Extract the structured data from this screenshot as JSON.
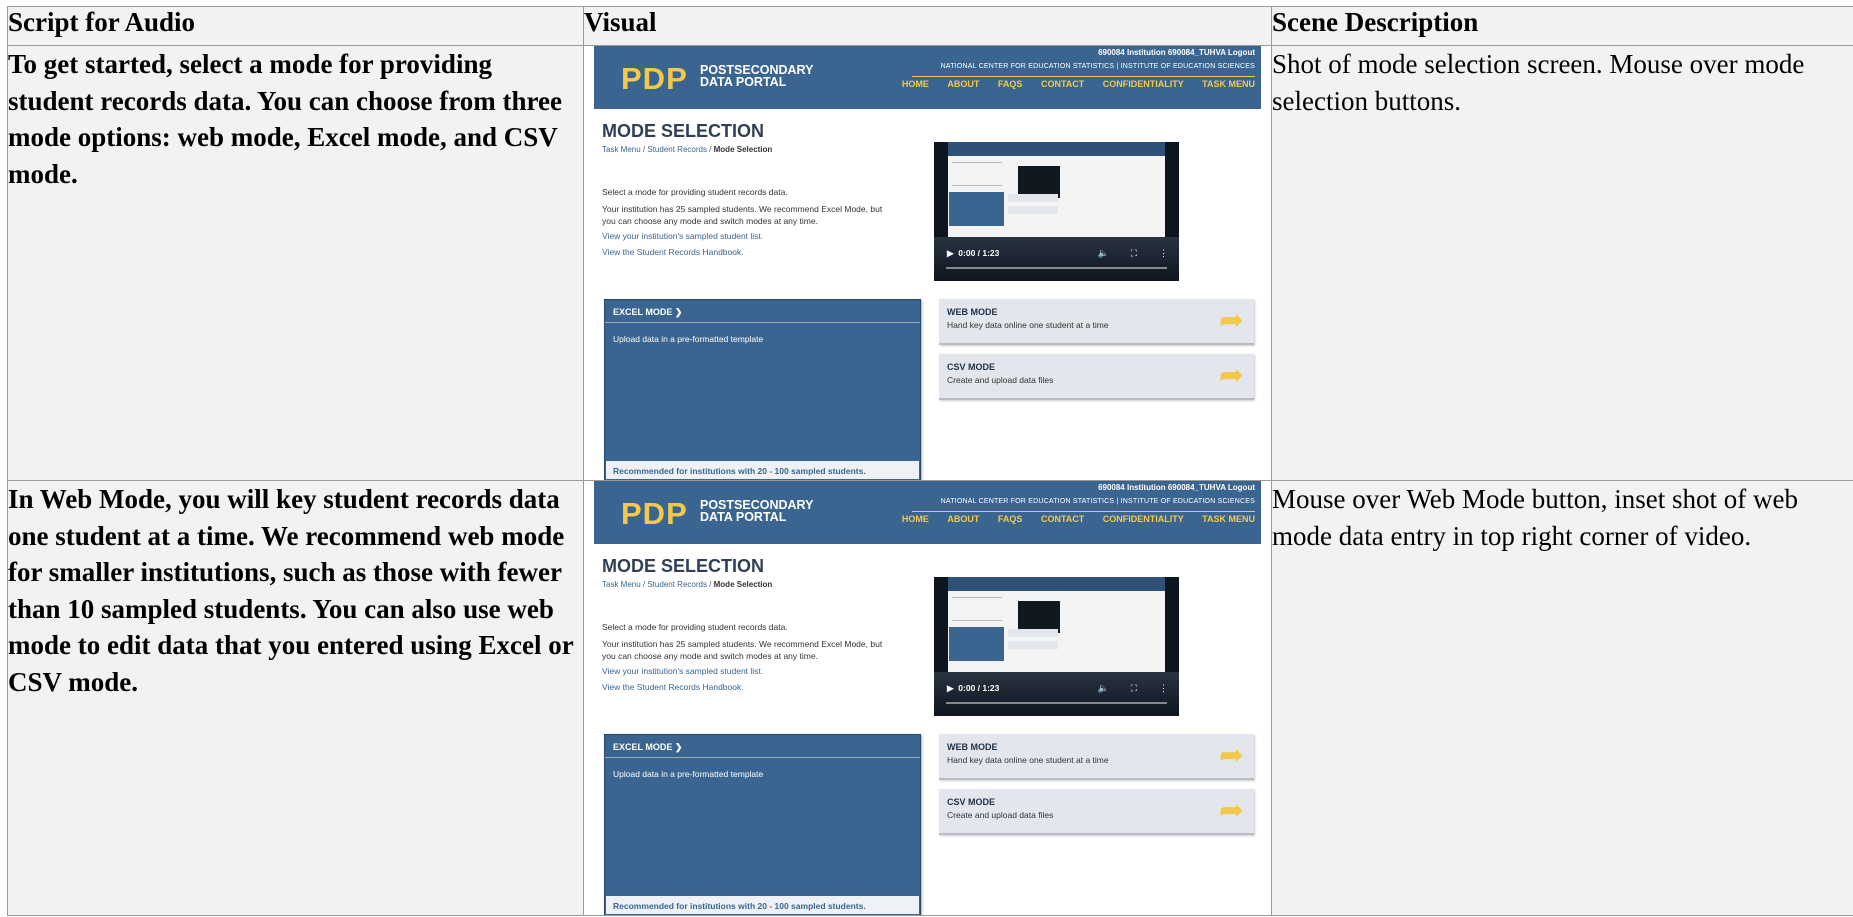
{
  "headers": {
    "script": "Script for Audio",
    "visual": "Visual",
    "scene": "Scene Description"
  },
  "rows": [
    {
      "script": "To get started, select a mode for providing student records data. You can choose from three mode options: web mode, Excel mode, and CSV mode.",
      "scene": "Shot of mode selection screen. Mouse over mode selection buttons."
    },
    {
      "script": "In Web Mode, you will key student records data one student at a time. We recommend web mode for smaller institutions, such as those with fewer than 10 sampled students. You can also use web mode to edit data that you entered using Excel or CSV mode.",
      "scene": "Mouse over Web Mode button, inset shot of web mode data entry in top right corner of video."
    }
  ],
  "portal": {
    "logo_mark": "PDP",
    "logo_line1": "POSTSECONDARY",
    "logo_line2": "DATA PORTAL",
    "account": "690084 Institution  690084_TUHVA   Logout",
    "agency": "NATIONAL CENTER FOR EDUCATION STATISTICS  |  INSTITUTE OF EDUCATION SCIENCES",
    "nav": [
      "HOME",
      "ABOUT",
      "FAQS",
      "CONTACT",
      "CONFIDENTIALITY",
      "TASK MENU"
    ],
    "title": "MODE SELECTION",
    "crumb_link1": "Task Menu",
    "crumb_link2": "Student Records",
    "crumb_current": "Mode Selection",
    "sep": " / ",
    "intro": "Select a mode for providing student records data.",
    "recommend": "Your institution has 25 sampled students. We recommend Excel Mode, but you can choose any mode and switch modes at any time.",
    "link_list": "View your institution's sampled student list.",
    "link_handbook": "View the Student Records Handbook.",
    "video_time": "0:00 / 1:23",
    "video_volume_icon": "🔈",
    "video_fullscreen_icon": "⛶",
    "video_menu_icon": "⋮",
    "video_play_icon": "▶",
    "excel_title": "EXCEL MODE ❯",
    "excel_desc": "Upload data in a pre-formatted template",
    "excel_foot": "Recommended for institutions with 20 - 100 sampled students.",
    "web_title": "WEB MODE",
    "web_desc": "Hand key data online one student at a time",
    "csv_title": "CSV MODE",
    "csv_desc": "Create and upload data files",
    "arrow_icon": "➦"
  }
}
